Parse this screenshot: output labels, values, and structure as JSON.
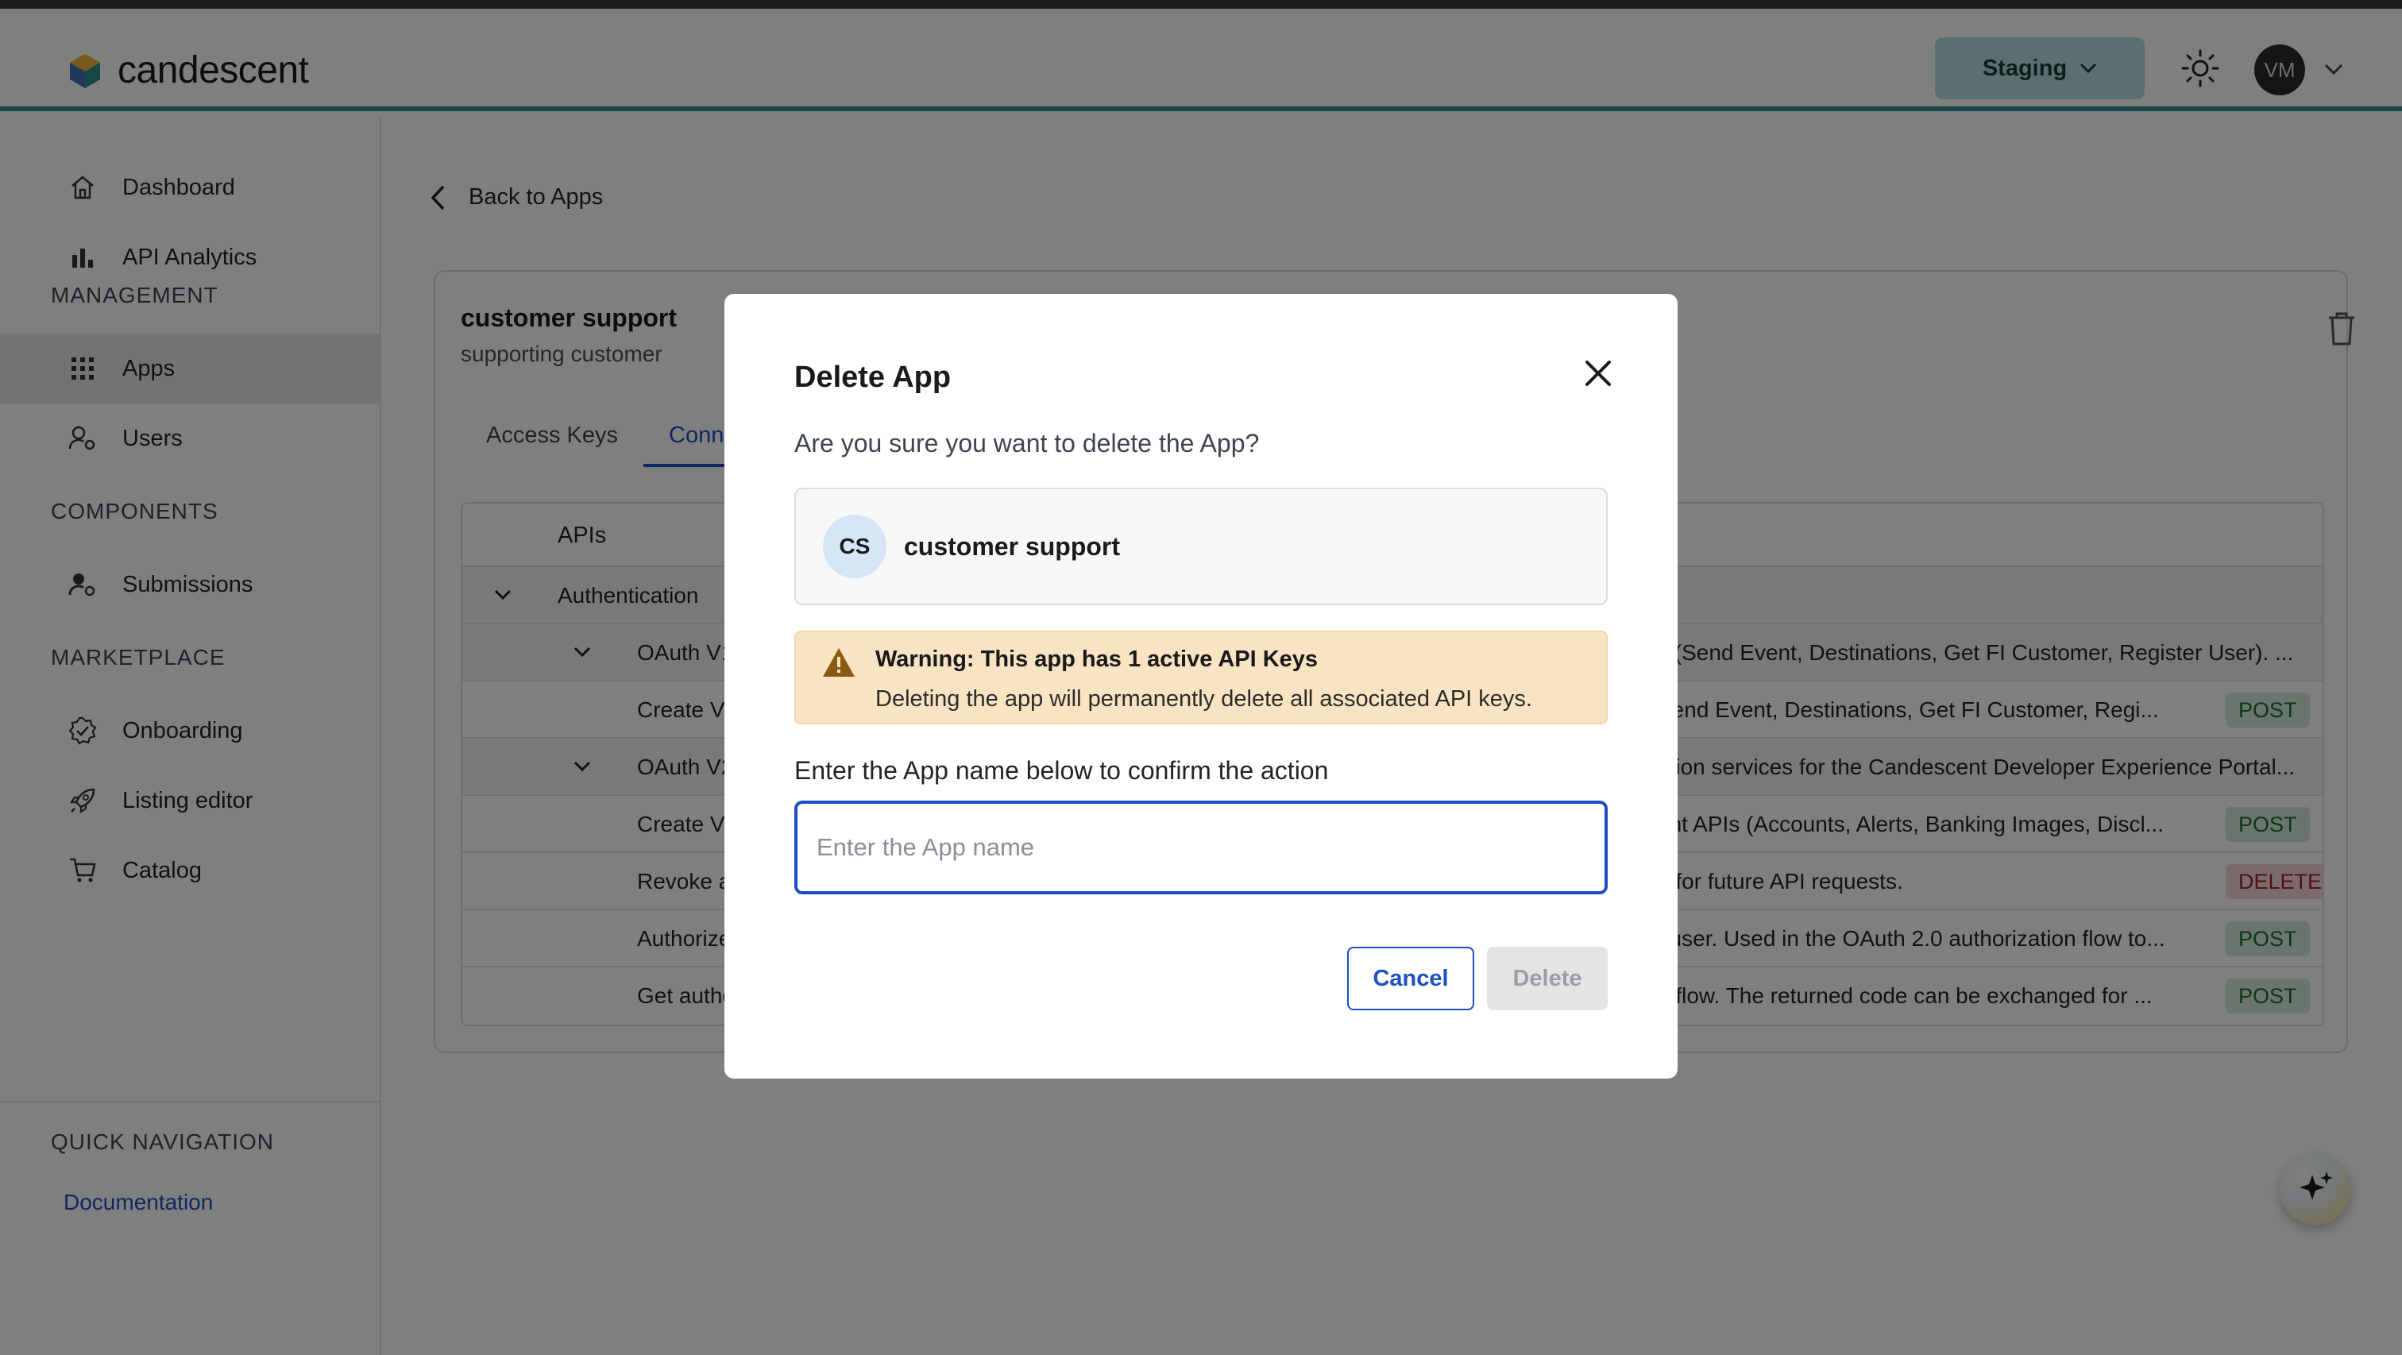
{
  "header": {
    "logo_text": "candescent",
    "environment": "Staging",
    "user_initials": "VM"
  },
  "sidebar": {
    "top_items": [
      {
        "label": "Dashboard",
        "icon": "home-icon"
      },
      {
        "label": "API Analytics",
        "icon": "bar-chart-icon"
      }
    ],
    "sections": [
      {
        "title": "MANAGEMENT",
        "items": [
          {
            "label": "Apps",
            "icon": "grid-icon",
            "active": true
          },
          {
            "label": "Users",
            "icon": "user-gear-icon"
          }
        ]
      },
      {
        "title": "COMPONENTS",
        "items": [
          {
            "label": "Submissions",
            "icon": "user-gear-icon"
          }
        ]
      },
      {
        "title": "MARKETPLACE",
        "items": [
          {
            "label": "Onboarding",
            "icon": "badge-check-icon"
          },
          {
            "label": "Listing editor",
            "icon": "rocket-icon"
          },
          {
            "label": "Catalog",
            "icon": "cart-icon"
          }
        ]
      }
    ],
    "quick_nav": {
      "title": "QUICK NAVIGATION",
      "link": "Documentation"
    }
  },
  "main": {
    "back_label": "Back to Apps",
    "app": {
      "name": "customer support",
      "description": "supporting customer"
    },
    "tabs": [
      {
        "label": "Access Keys",
        "active": false
      },
      {
        "label": "Conne",
        "active": true
      }
    ],
    "table": {
      "header": "APIs",
      "group": "Authentication",
      "rows": [
        {
          "name": "OAuth V1",
          "desc": "y (Send Event, Destinations, Get FI Customer, Register User). ...",
          "method": ""
        },
        {
          "name": "Create V",
          "desc": "Send Event, Destinations, Get FI Customer, Regi...",
          "method": "POST"
        },
        {
          "name": "OAuth V2",
          "desc": "ation services for the Candescent Developer Experience Portal...",
          "method": ""
        },
        {
          "name": "Create V:",
          "desc": "ent APIs (Accounts, Alerts, Banking Images, Discl...",
          "method": "POST"
        },
        {
          "name": "Revoke a",
          "desc": "e for future API requests.",
          "method": "DELETE"
        },
        {
          "name": "Authorize",
          "desc": ", user. Used in the OAuth 2.0 authorization flow to...",
          "method": "POST"
        },
        {
          "name": "Get autho",
          "desc": "e flow. The returned code can be exchanged for ...",
          "method": "POST"
        }
      ]
    }
  },
  "modal": {
    "title": "Delete App",
    "question": "Are you sure you want to delete the App?",
    "app_initials": "CS",
    "app_name": "customer support",
    "warning_title": "Warning: This app has 1 active API Keys",
    "warning_text": "Deleting the app will permanently delete all associated API keys.",
    "confirm_label": "Enter the App name below to confirm the action",
    "input_placeholder": "Enter the App name",
    "input_value": "",
    "cancel_label": "Cancel",
    "delete_label": "Delete"
  }
}
